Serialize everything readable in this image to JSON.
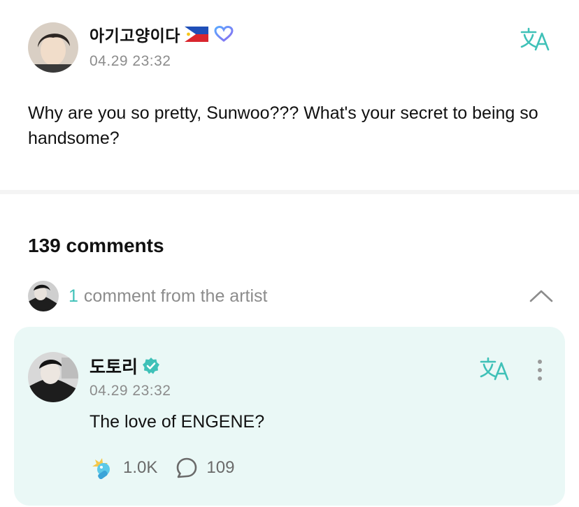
{
  "post": {
    "author_name": "아기고양이다",
    "author_flag": "philippines-flag-icon",
    "author_badge": "heart-badge-icon",
    "date": "04.29 23:32",
    "body": "Why are you so pretty, Sunwoo??? What's your secret to being so handsome?",
    "translate_icon": "translate-icon"
  },
  "comments": {
    "count_label": "139 comments",
    "artist_section": {
      "count": "1",
      "label": "comment from the artist",
      "expanded": true
    },
    "artist_comment": {
      "author_name": "도토리",
      "verified": true,
      "date": "04.29 23:32",
      "text": "The love of ENGENE?",
      "reaction_count": "1.0K",
      "reply_count": "109"
    }
  },
  "colors": {
    "accent": "#3fc1b8",
    "artist_card_bg": "#eaf8f6",
    "muted_text": "#8c8c8c"
  }
}
